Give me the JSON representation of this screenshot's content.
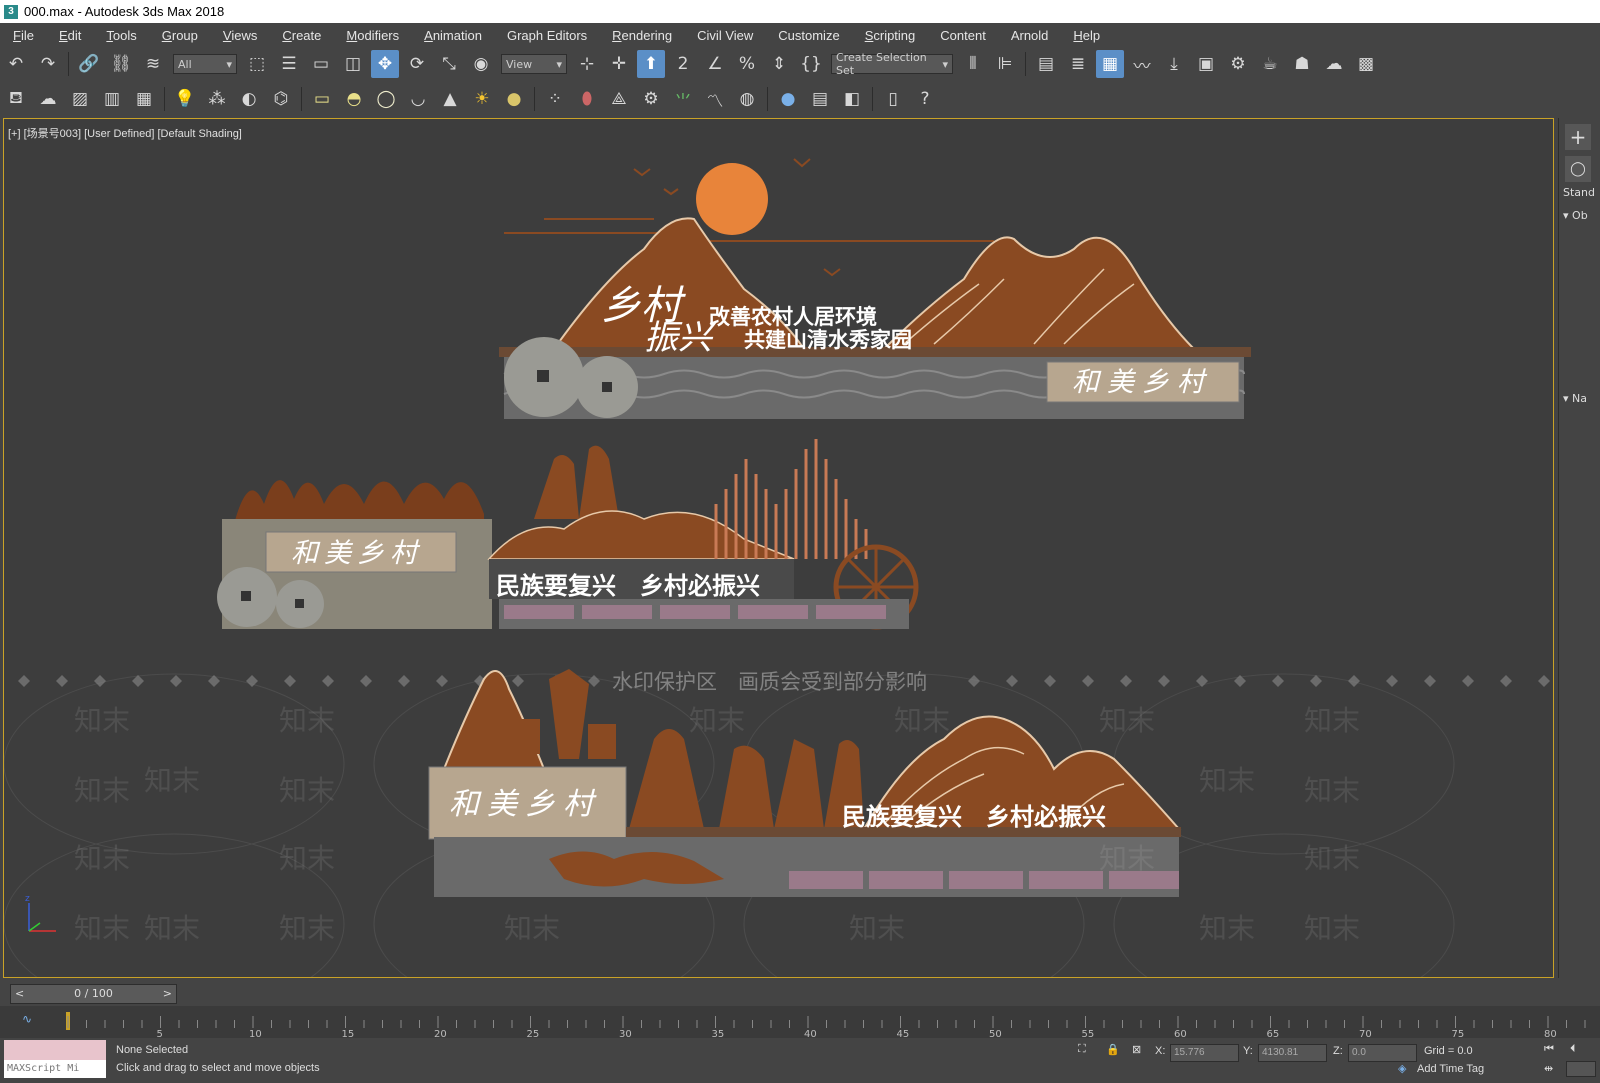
{
  "window": {
    "title": "000.max - Autodesk 3ds Max 2018"
  },
  "menu": [
    {
      "key": "F",
      "rest": "ile"
    },
    {
      "key": "E",
      "rest": "dit"
    },
    {
      "key": "T",
      "rest": "ools"
    },
    {
      "key": "G",
      "rest": "roup"
    },
    {
      "key": "V",
      "rest": "iews"
    },
    {
      "key": "C",
      "rest": "reate"
    },
    {
      "key": "M",
      "rest": "odifiers"
    },
    {
      "key": "A",
      "rest": "nimation"
    },
    {
      "key": "",
      "rest": "Graph Editors"
    },
    {
      "key": "R",
      "rest": "endering"
    },
    {
      "key": "",
      "rest": "Civil View"
    },
    {
      "key": "",
      "rest": "Customize"
    },
    {
      "key": "S",
      "rest": "cripting"
    },
    {
      "key": "",
      "rest": "Content"
    },
    {
      "key": "",
      "rest": "Arnold"
    },
    {
      "key": "H",
      "rest": "elp"
    }
  ],
  "toolbar": {
    "filter_dropdown": "All",
    "refcoord_dropdown": "View",
    "selection_set_dropdown": "Create Selection Set"
  },
  "viewport": {
    "label": "[+] [场景号003] [User Defined] [Default Shading]",
    "scene_texts": {
      "top_calligraphy_1": "乡村",
      "top_calligraphy_2": "振兴",
      "top_slogan_1": "改善农村人居环境",
      "top_slogan_2": "共建山清水秀家园",
      "top_sign": "和美乡村",
      "mid_sign": "和美乡村",
      "mid_slogan": "民族要复兴　乡村必振兴",
      "bottom_sign": "和美乡村",
      "bottom_slogan": "民族要复兴　乡村必振兴"
    },
    "watermark_banner": "水印保护区　画质会受到部分影响",
    "watermark_text": "知末"
  },
  "command_panel": {
    "label1": "Stand",
    "label2": "Ob",
    "label3": "Na"
  },
  "timeline": {
    "frame_display": "0 / 100",
    "ticks": [
      "5",
      "10",
      "15",
      "20",
      "25",
      "30",
      "35",
      "40",
      "45",
      "50",
      "55",
      "60",
      "65",
      "70",
      "75",
      "80"
    ]
  },
  "status": {
    "selection": "None Selected",
    "prompt": "Click and drag to select and move objects",
    "maxscript": "MAXScript Mi",
    "x_label": "X:",
    "x_value": "15.776",
    "y_label": "Y:",
    "y_value": "4130.81",
    "z_label": "Z:",
    "z_value": "0.0",
    "grid": "Grid = 0.0",
    "add_time_tag": "Add Time Tag"
  },
  "colors": {
    "viewport_border": "#c9a227",
    "active_tool": "#5b8fc7",
    "rust": "#8a4a22",
    "sun": "#e8843a"
  }
}
